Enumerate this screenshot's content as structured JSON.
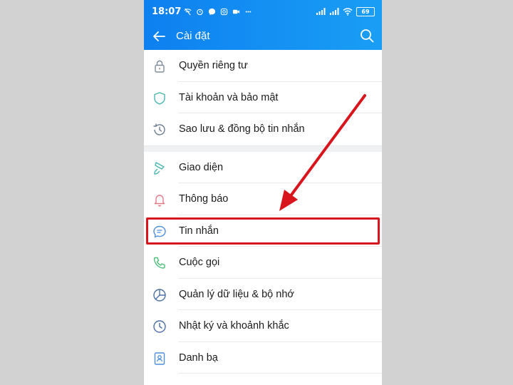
{
  "status_bar": {
    "time": "18:07",
    "battery": "69",
    "icons": [
      "wifi-off-icon",
      "alarm-icon",
      "messenger-icon",
      "instagram-icon",
      "video-icon",
      "more-dots-icon",
      "signal-icon",
      "signal-icon",
      "wifi-icon",
      "battery-icon"
    ]
  },
  "header": {
    "title": "Cài đặt",
    "back_icon": "back-arrow-icon",
    "search_icon": "search-icon"
  },
  "colors": {
    "header": "#1a8ef2",
    "highlight_box": "#d8141c",
    "arrow": "#d8141c"
  },
  "settings": {
    "group1": [
      {
        "label": "Quyền riêng tư",
        "icon": "lock-icon"
      },
      {
        "label": "Tài khoản và bảo mật",
        "icon": "shield-icon"
      },
      {
        "label": "Sao lưu & đồng bộ tin nhắn",
        "icon": "backup-clock-icon"
      }
    ],
    "group2": [
      {
        "label": "Giao diện",
        "icon": "paint-brush-icon"
      },
      {
        "label": "Thông báo",
        "icon": "bell-icon"
      },
      {
        "label": "Tin nhắn",
        "icon": "message-bubble-icon"
      },
      {
        "label": "Cuộc gọi",
        "icon": "phone-icon"
      },
      {
        "label": "Quản lý dữ liệu & bộ nhớ",
        "icon": "pie-chart-icon"
      },
      {
        "label": "Nhật ký và khoảnh khắc",
        "icon": "clock-icon"
      },
      {
        "label": "Danh bạ",
        "icon": "contact-card-icon"
      }
    ]
  }
}
